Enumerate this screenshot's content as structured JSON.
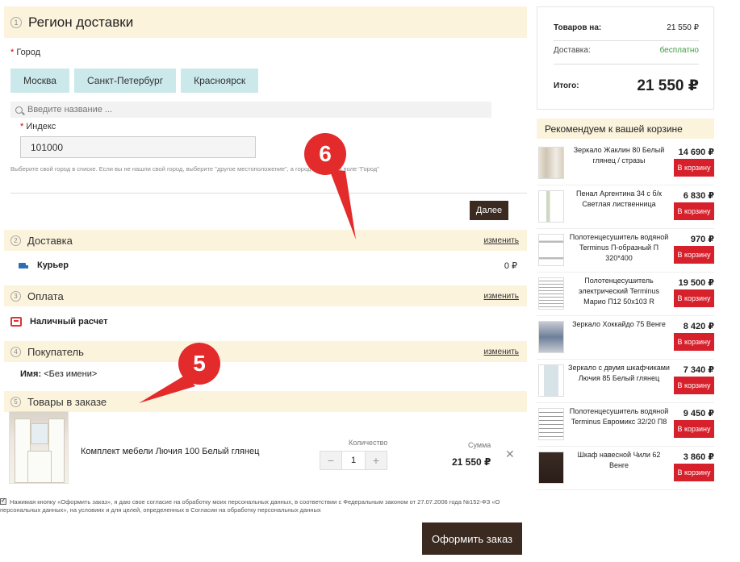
{
  "region": {
    "num": "1",
    "title": "Регион доставки",
    "city_label": "Город",
    "cities": [
      "Москва",
      "Санкт-Петербург",
      "Красноярск"
    ],
    "search_placeholder": "Введите название ...",
    "index_label": "Индекс",
    "index_value": "101000",
    "hint": "Выберите свой город в списке. Если вы не нашли свой город, выберите \"другое местоположение\", а город впишите в поле \"Город\"",
    "next_label": "Далее"
  },
  "delivery": {
    "num": "2",
    "title": "Доставка",
    "change": "изменить",
    "method": "Курьер",
    "price": "0 ₽"
  },
  "payment": {
    "num": "3",
    "title": "Оплата",
    "change": "изменить",
    "method": "Наличный расчет"
  },
  "buyer": {
    "num": "4",
    "title": "Покупатель",
    "change": "изменить",
    "name_label": "Имя:",
    "name_value": "<Без имени>"
  },
  "goods": {
    "num": "5",
    "title": "Товары в заказе",
    "product_name": "Комплект мебели Лючия 100 Белый глянец",
    "qty_label": "Количество",
    "qty_value": "1",
    "minus": "−",
    "plus": "+",
    "sum_label": "Сумма",
    "sum_value": "21 550 ₽",
    "remove": "✕"
  },
  "agreement": "Нажимая кнопку «Оформить заказ», я даю свое согласие на обработку моих персональных данных, в соответствии с Федеральным законом от 27.07.2006 года №152-ФЗ «О персональных данных», на условиях и для целей, определенных в Согласии на обработку персональных данных",
  "order_button": "Оформить заказ",
  "annotations": {
    "a6": "6",
    "a5": "5",
    "color": "#e32b2b"
  },
  "totals": {
    "goods_label": "Товаров на:",
    "goods_value": "21 550 ₽",
    "delivery_label": "Доставка:",
    "delivery_value": "бесплатно",
    "total_label": "Итого:",
    "total_value": "21 550 ₽"
  },
  "recommend": {
    "title": "Рекомендуем к вашей корзине",
    "buy_label": "В корзину",
    "items": [
      {
        "name": "Зеркало Жаклин 80 Белый глянец / стразы",
        "price": "14 690 ₽"
      },
      {
        "name": "Пенал Аргентина 34 с б/к Светлая лиственница",
        "price": "6 830 ₽"
      },
      {
        "name": "Полотенцесушитель водяной Terminus П-образный П 320*400",
        "price": "970 ₽"
      },
      {
        "name": "Полотенцесушитель электрический Terminus Марио П12 50х103 R",
        "price": "19 500 ₽"
      },
      {
        "name": "Зеркало Хоккайдо 75 Венге",
        "price": "8 420 ₽"
      },
      {
        "name": "Зеркало с двумя шкафчиками Лючия 85 Белый глянец",
        "price": "7 340 ₽"
      },
      {
        "name": "Полотенцесушитель водяной Terminus Евромикс 32/20 П8",
        "price": "9 450 ₽"
      },
      {
        "name": "Шкаф навесной Чили 62 Венге",
        "price": "3 860 ₽"
      }
    ]
  }
}
